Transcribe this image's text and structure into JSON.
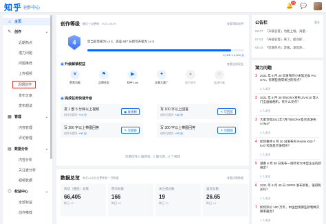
{
  "header": {
    "logo": "知乎",
    "subtitle": "创作中心",
    "notification_count": "24"
  },
  "sidebar": {
    "items": [
      {
        "label": "主页",
        "icon": "home-icon"
      },
      {
        "label": "创作",
        "icon": "pencil-icon"
      },
      {
        "label": "近期热点"
      },
      {
        "label": "潜力问题"
      },
      {
        "label": "问题推荐"
      },
      {
        "label": "上传视频"
      },
      {
        "label": "近期创作"
      },
      {
        "label": "发布文章"
      },
      {
        "label": "发布想法"
      },
      {
        "label": "管理",
        "icon": "grid-icon"
      },
      {
        "label": "内容管理"
      },
      {
        "label": "评论管理"
      },
      {
        "label": "数据分析",
        "icon": "chart-icon"
      },
      {
        "label": "内容分析"
      },
      {
        "label": "关注者分析"
      },
      {
        "label": "视频数据"
      },
      {
        "label": "权益中心",
        "icon": "gift-icon"
      },
      {
        "label": "全部权益"
      },
      {
        "label": "创作推荐"
      }
    ]
  },
  "level": {
    "title": "创作等级",
    "updated": "最近一次更新：2021-08-29",
    "help_link": "查看等级说明",
    "level_num": "4",
    "desc_line1": "您当前等级为 Lv 4，还差 847 分即可升级为 Lv 5",
    "score": "9,153 / 10,000 分",
    "progress": 0.915
  },
  "perks": {
    "title": "升级解锁权益",
    "link": "查看全部权益",
    "items": [
      {
        "label": "赞赏功能",
        "icon": "coin-icon",
        "locked": false
      },
      {
        "label": "品牌任务",
        "icon": "flag-icon",
        "locked": false
      },
      {
        "label": "知乎 Live",
        "icon": "live-icon",
        "locked": false
      },
      {
        "label": "文章大赛广",
        "icon": "trophy-icon",
        "locked": false
      },
      {
        "label": "成为答主",
        "icon": "mic-icon",
        "locked": true
      },
      {
        "label": "盐选作者",
        "icon": "star-icon",
        "locked": true
      }
    ]
  },
  "tasks": {
    "title": "完成任务快速升级",
    "items": [
      {
        "title": "发 1 部 5 分钟以上视频",
        "reward_prefix": "创作分提升",
        "reward": "+70 分",
        "button": "发视频"
      },
      {
        "title": "写 100 字以上回答",
        "reward_prefix": "创作分提升",
        "reward": "+30 分",
        "button": "写回答"
      },
      {
        "title": "写 200 字以上带图回答",
        "reward_prefix": "创作分提升",
        "reward": "+40 分",
        "button": "写回答"
      },
      {
        "title": "写 300 字以上带图回答",
        "reward_prefix": "创作分提升",
        "reward": "+50 分",
        "button": "写回答"
      }
    ],
    "footer": "近期创作 0 篇回答，0 篇文章，0 个视频"
  },
  "overview": {
    "title": "数据总览",
    "subtitle": "每天12点左右更新前一日数据",
    "link": "查看详细数据",
    "stats": [
      {
        "label": "阅读（播放）总数",
        "value": "66,405",
        "delta": "昨日 +0"
      },
      {
        "label": "赞同总数",
        "value": "166",
        "delta": "昨日 +0"
      },
      {
        "label": "关注者总数",
        "value": "19",
        "delta": "昨日 +0"
      },
      {
        "label": "喜欢总数",
        "value": "26.65",
        "delta": "昨日 +0"
      }
    ]
  },
  "notices": {
    "title": "公告栏",
    "link": "更多",
    "items": [
      {
        "date": "08-27",
        "text": "「升级答客」功能上线，海量..."
      },
      {
        "date": "07-03",
        "text": "「升级答客」来了，提问即..."
      },
      {
        "date": "05-24",
        "text": "「近期热点」改版，发现热..."
      }
    ]
  },
  "hot": {
    "title": "潜力问题",
    "items": [
      {
        "num": "1",
        "text": "2021 年 8 月 30 日发布的小米笔记本 Pro X70，有哪些值得关注的亮点？",
        "count": "3 人关注"
      },
      {
        "num": "2",
        "text": "2021 年 8 月 30 日SONY发布 ZV-E10 等入门全画幅相机，有什么亮点？",
        "count": "2 人关注"
      },
      {
        "num": "3",
        "text": "大家觉得2021年7月7日SONY是否会发布A7M4？",
        "count": "3 人关注"
      },
      {
        "num": "4",
        "text": "如何看待 8 月 30 日发布的 Redmi K50 ？ K40 究竟是否值得买？",
        "count": "3 人关注"
      },
      {
        "num": "5",
        "text": "湖南 8 月 30 日发布一则针对大中型企业的新规定？",
        "count": "2 人关注"
      },
      {
        "num": "6",
        "text": "2021 年 8 月 30 日 OPPO 发布新机，值得购买吗？",
        "count": "1 人关注"
      },
      {
        "num": "7",
        "text": "如何评价 100 万年，中国出现哪些新物种灭绝率最高？",
        "count": "1 人关注"
      }
    ]
  }
}
